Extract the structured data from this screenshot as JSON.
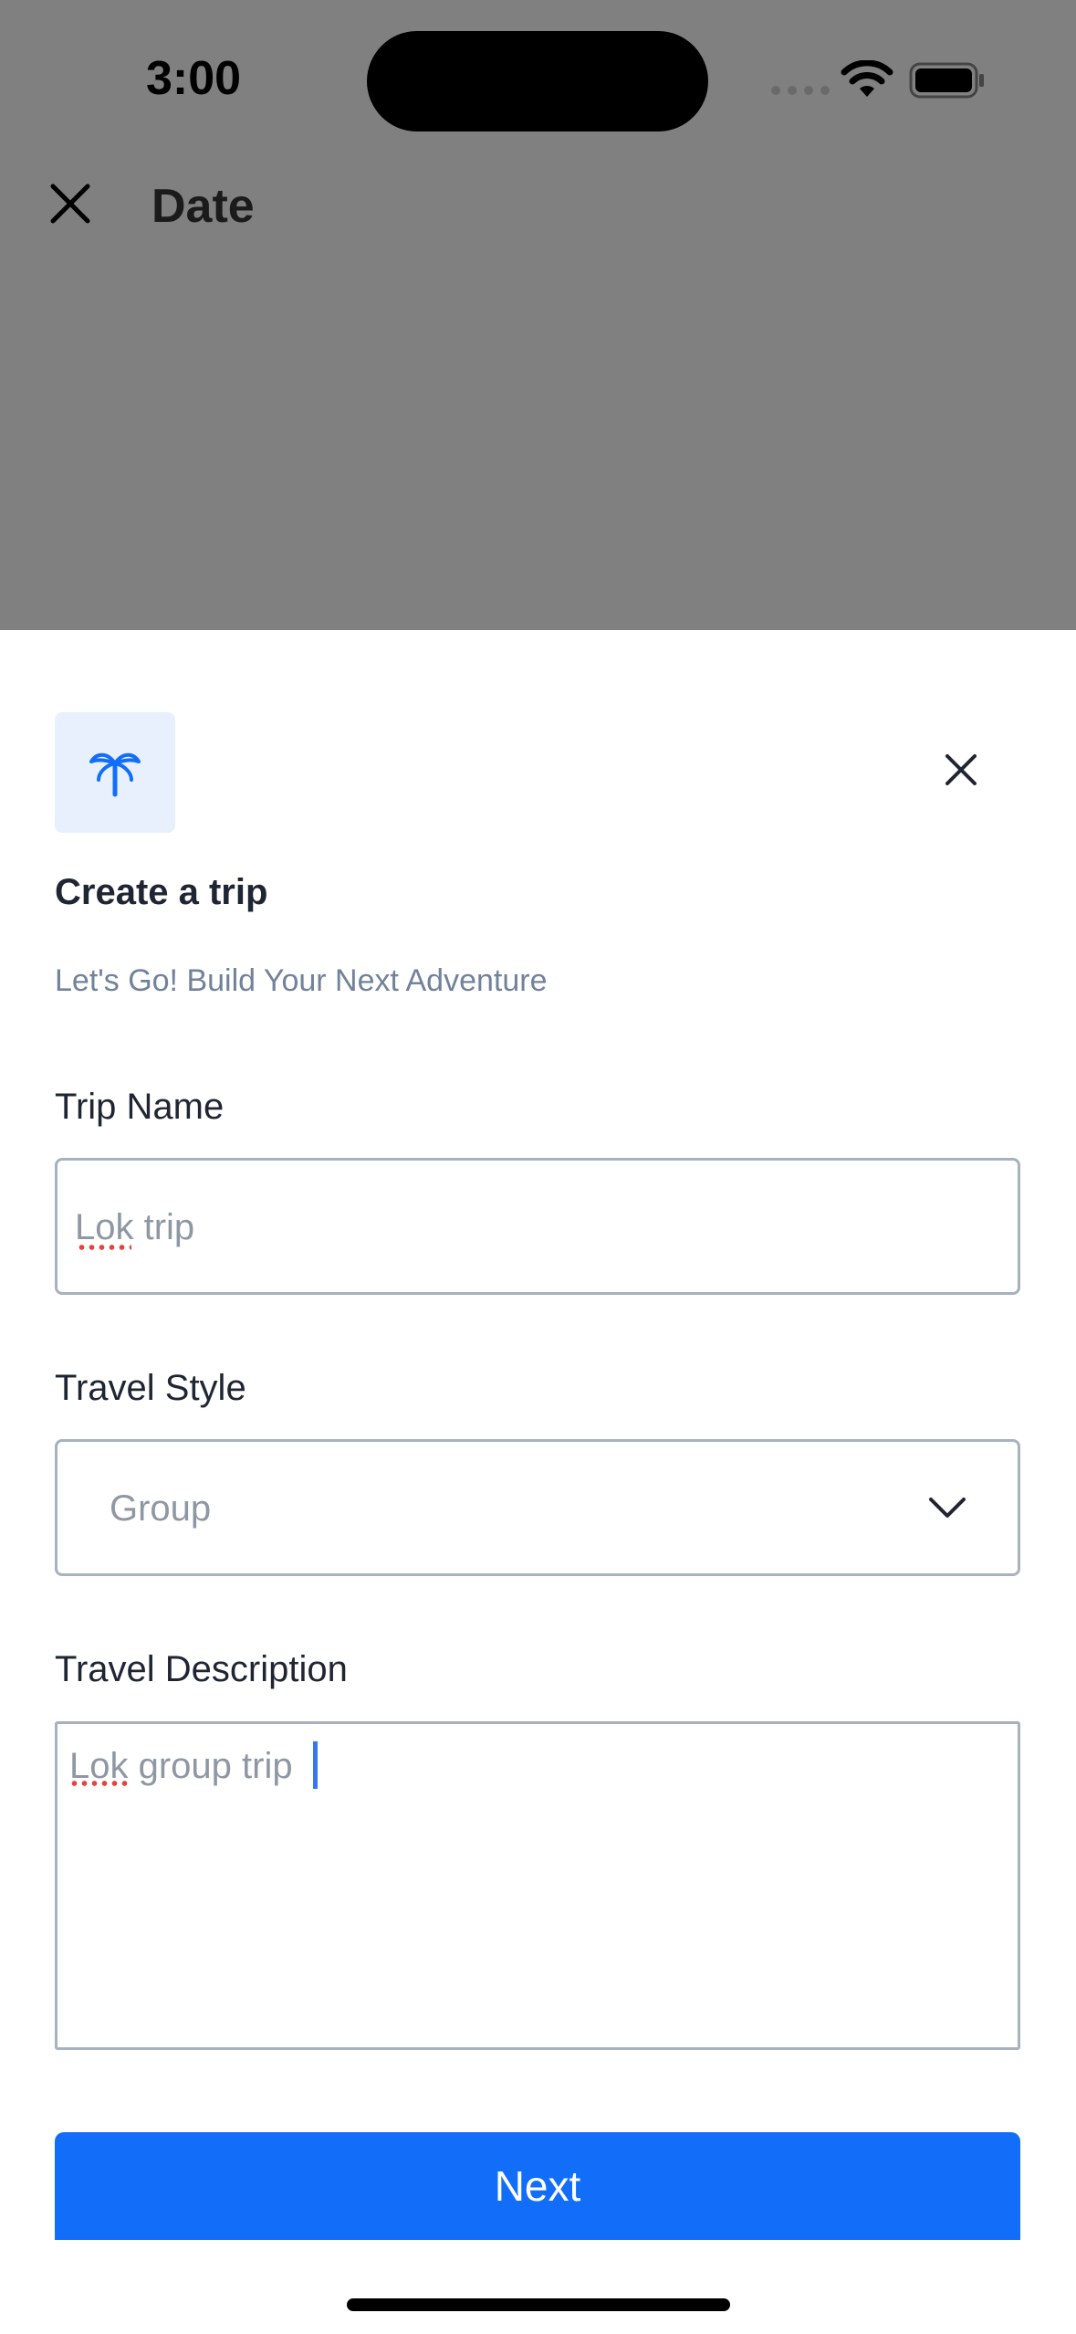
{
  "status_bar": {
    "time": "3:00"
  },
  "background_screen": {
    "title": "Date"
  },
  "sheet": {
    "title": "Create a trip",
    "subtitle": "Let's Go! Build Your Next Adventure",
    "trip_name": {
      "label": "Trip Name",
      "value": "Lok trip"
    },
    "travel_style": {
      "label": "Travel Style",
      "selected": "Group"
    },
    "travel_description": {
      "label": "Travel Description",
      "value": "Lok group trip"
    },
    "next_label": "Next"
  },
  "icons": [
    "close-icon",
    "palm-tree-icon",
    "chevron-down-icon",
    "wifi-icon",
    "battery-icon"
  ],
  "colors": {
    "accent": "#126ef9",
    "icon_bg": "#e8f0fd",
    "backdrop": "#808080"
  }
}
